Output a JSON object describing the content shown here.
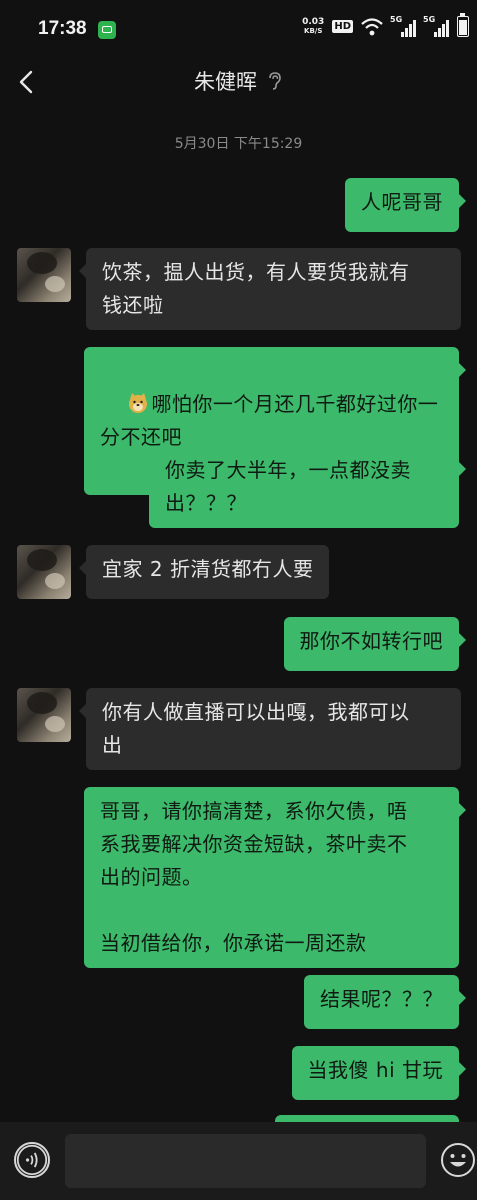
{
  "status_bar": {
    "time": "17:38",
    "speed_value": "0.03",
    "speed_unit": "KB/S",
    "hd_label": "HD",
    "sim1": "5G",
    "sim2": "5G",
    "icons": [
      "message-app-icon",
      "hd-icon",
      "wifi-icon",
      "signal-icon",
      "signal-icon",
      "battery-icon"
    ]
  },
  "header": {
    "title": "朱健晖",
    "icons": [
      "back-icon",
      "earpiece-icon"
    ]
  },
  "timestamp": "5月30日 下午15:29",
  "messages": [
    {
      "side": "right",
      "text": "人呢哥哥"
    },
    {
      "side": "left",
      "text": "饮茶，揾人出货，有人要货我就有\n钱还啦"
    },
    {
      "side": "right",
      "emoji": "doge-emoji",
      "text": "哪怕你一个月还几千都好过你一\n分不还吧"
    },
    {
      "side": "right",
      "text": "你卖了大半年，一点都没卖\n出？？？"
    },
    {
      "side": "left",
      "text": "宜家 2 折清货都冇人要"
    },
    {
      "side": "right",
      "text": "那你不如转行吧"
    },
    {
      "side": "left",
      "text": "你有人做直播可以出嘎，我都可以\n出"
    },
    {
      "side": "right",
      "text": "哥哥，请你搞清楚，系你欠债，唔\n系我要解决你资金短缺，茶叶卖不\n出的问题。\n\n当初借给你，你承诺一周还款"
    },
    {
      "side": "right",
      "text": "结果呢？？？"
    },
    {
      "side": "right",
      "text": "当我傻 hi 甘玩"
    }
  ],
  "input_bar": {
    "value": "",
    "icons": [
      "voice-icon",
      "emoji-icon"
    ]
  },
  "colors": {
    "background": "#111111",
    "sent_bubble": "#3cb96a",
    "received_bubble": "#2c2c2c"
  }
}
